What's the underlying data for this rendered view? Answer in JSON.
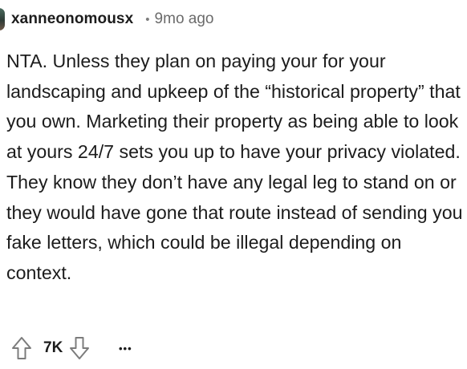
{
  "comment": {
    "author": "xanneonomousx",
    "separator": "•",
    "age": "9mo ago",
    "body": "NTA. Unless they plan on paying your for your landscaping and upkeep of the “historical property” that you own. Marketing their property as being able to look at yours 24/7 sets you up to have your privacy violated. They know they don’t have any legal leg to stand on or they would have gone that route instead of sending you fake letters, which could be illegal depending on context.",
    "vote_count": "7K",
    "more_label": "•••"
  },
  "icons": {
    "upvote": "arrow-up-outline-icon",
    "downvote": "arrow-down-outline-icon",
    "more": "more-horizontal-icon",
    "avatar": "user-avatar"
  },
  "colors": {
    "text": "#1c1c1c",
    "meta": "#6b6b6b",
    "icon_stroke": "#7c7c7c",
    "background": "#ffffff"
  }
}
